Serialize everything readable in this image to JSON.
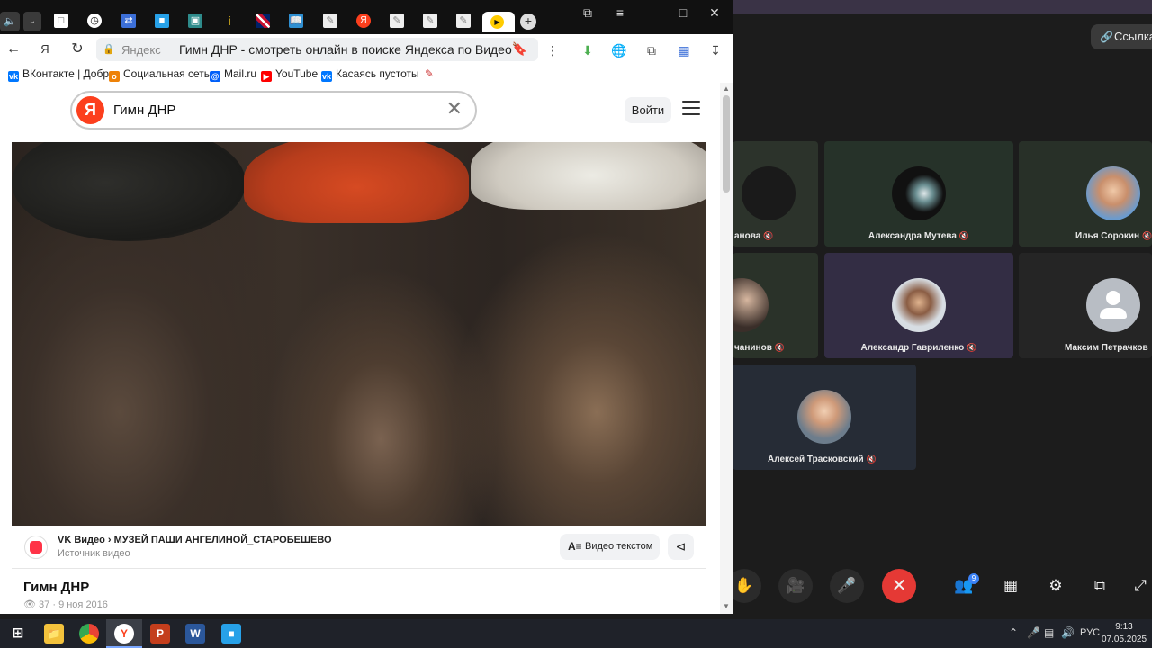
{
  "conference": {
    "link_button_label": "Ссылка",
    "participants": [
      {
        "name": "анова",
        "avatar": "photo"
      },
      {
        "name": "Александра Мутева",
        "avatar": "photo"
      },
      {
        "name": "Илья Сорокин",
        "avatar": "photo"
      },
      {
        "name": "чанинов",
        "avatar": "photo"
      },
      {
        "name": "Александр Гавриленко",
        "avatar": "photo"
      },
      {
        "name": "Максим Петрачков",
        "avatar": "default-user-icon"
      },
      {
        "name": "Алексей Трасковский",
        "avatar": "photo"
      }
    ],
    "participants_badge": "9",
    "controls": [
      "hand-icon",
      "camera-icon",
      "mic-icon",
      "end-call-icon",
      "participants-icon",
      "layout-icon",
      "settings-icon",
      "pip-icon",
      "fullscreen-icon"
    ]
  },
  "browser": {
    "host": "Яндекс",
    "page_title": "Гимн ДНР - смотреть онлайн в поиске Яндекса по Видео",
    "bookmarks": [
      "ВКонтакте | Добр",
      "Социальная сеть",
      "Mail.ru",
      "YouTube",
      "Касаясь пустоты"
    ],
    "search_query": "Гимн ДНР",
    "logo_letter": "Я",
    "login_label": "Войти",
    "source_title": "VK Видео › МУЗЕЙ ПАШИ АНГЕЛИНОЙ_СТАРОБЕШЕВО",
    "source_subtitle": "Источник видео",
    "video_text_label": "Видео текстом",
    "video_title": "Гимн ДНР",
    "video_views": "37",
    "video_date": "9 ноя 2016"
  },
  "taskbar": {
    "language": "РУС",
    "time": "9:13",
    "date": "07.05.2025"
  },
  "colors": {
    "yandex_red": "#fc3f1d",
    "end_call_red": "#e53935",
    "taskbar_bg": "#1f2229"
  }
}
